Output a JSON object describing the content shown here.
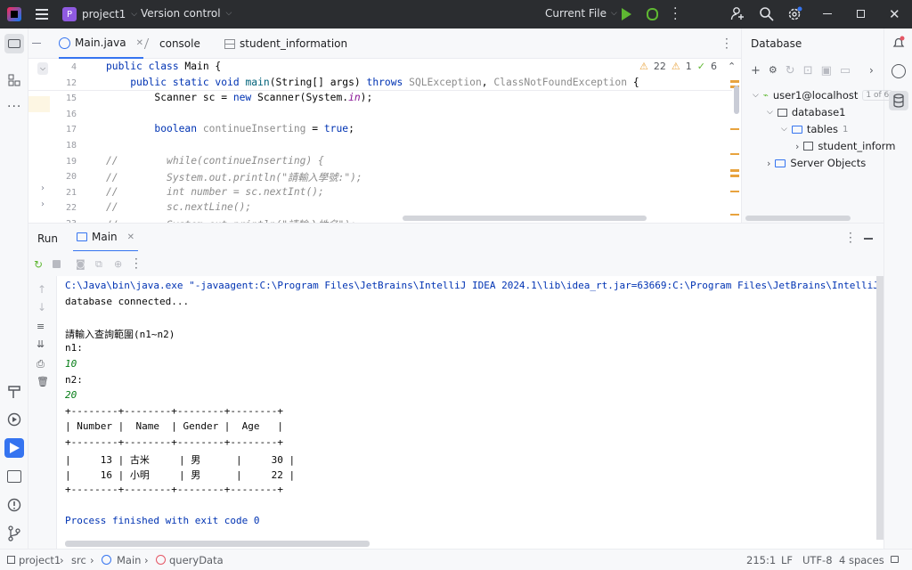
{
  "title_bar": {
    "project_badge": "P",
    "project": "project1",
    "vcs": "Version control",
    "run_config": "Current File"
  },
  "editor_tabs": [
    {
      "label": "Main.java"
    },
    {
      "label": "console"
    },
    {
      "label": "student_information"
    }
  ],
  "inspections": {
    "warnings": "22",
    "weak": "1",
    "ok": "6"
  },
  "editor": {
    "lines": [
      {
        "n": "4",
        "html": "<span class='kw'>public class</span> Main {"
      },
      {
        "n": "12",
        "html": "    <span class='kw'>public static void</span> <span style='color:#00627a'>main</span>(String[] args) <span class='kw'>throws</span> <span class='gr'>SQLException</span>, <span class='gr'>ClassNotFoundException</span> {"
      },
      {
        "n": "15",
        "html": "        Scanner sc = <span class='kw'>new</span> Scanner(System.<span class='fld'>in</span>);"
      },
      {
        "n": "16",
        "html": ""
      },
      {
        "n": "17",
        "html": "        <span class='kw'>boolean</span> <span class='gr'>continueInserting</span> = <span class='kw'>true</span>;"
      },
      {
        "n": "18",
        "html": ""
      },
      {
        "n": "19",
        "html": "<span class='cm'>//        while(continueInserting) {</span>"
      },
      {
        "n": "20",
        "html": "<span class='cm'>//        System.out.println(\"請輸入學號:\");</span>"
      },
      {
        "n": "21",
        "html": "<span class='cm'>//        int number = sc.nextInt();</span>"
      },
      {
        "n": "22",
        "html": "<span class='cm'>//        sc.nextLine();</span>"
      },
      {
        "n": "23",
        "html": "<span class='cm'>//        System.out.println(\"請輸入姓名\");</span>"
      }
    ]
  },
  "database": {
    "title": "Database",
    "tree": [
      {
        "label": "user1@localhost",
        "badge": "1 of 6"
      },
      {
        "label": "database1"
      },
      {
        "label": "tables",
        "badge": "1"
      },
      {
        "label": "student_inform"
      },
      {
        "label": "Server Objects"
      }
    ]
  },
  "run": {
    "run_label": "Run",
    "tab_label": "Main"
  },
  "console_lines": [
    {
      "t": "C:\\Java\\bin\\java.exe \"-javaagent:C:\\Program Files\\JetBrains\\IntelliJ IDEA 2024.1\\lib\\idea_rt.jar=63669:C:\\Program Files\\JetBrains\\IntelliJ IDEA",
      "c": "#0033b3"
    },
    {
      "t": "database connected...",
      "c": "#080808"
    },
    {
      "t": "",
      "c": "#080808"
    },
    {
      "t": "請輸入查詢範圍(n1~n2)",
      "c": "#080808"
    },
    {
      "t": "n1:",
      "c": "#080808"
    },
    {
      "t": "10",
      "c": "#067d17",
      "i": true
    },
    {
      "t": "n2:",
      "c": "#080808"
    },
    {
      "t": "20",
      "c": "#067d17",
      "i": true
    },
    {
      "t": "+--------+--------+--------+--------+",
      "c": "#080808"
    },
    {
      "t": "| Number |  Name  | Gender |  Age   |",
      "c": "#080808"
    },
    {
      "t": "+--------+--------+--------+--------+",
      "c": "#080808"
    },
    {
      "t": "|     13 | 古米     | 男      |     30 |",
      "c": "#080808"
    },
    {
      "t": "|     16 | 小明     | 男      |     22 |",
      "c": "#080808"
    },
    {
      "t": "+--------+--------+--------+--------+",
      "c": "#080808"
    },
    {
      "t": "",
      "c": "#080808"
    },
    {
      "t": "Process finished with exit code 0",
      "c": "#0033b3"
    }
  ],
  "status": {
    "crumbs": [
      "project1",
      "src",
      "Main",
      "queryData"
    ],
    "position": "215:1",
    "line_sep": "LF",
    "encoding": "UTF-8",
    "indent": "4 spaces"
  },
  "colors": {
    "accent": "#3574f0",
    "titlebar": "#2b2d30",
    "run_green": "#5fb832"
  }
}
